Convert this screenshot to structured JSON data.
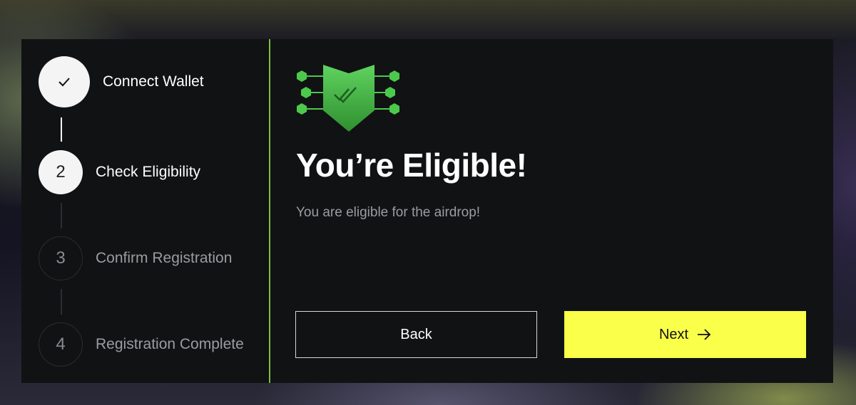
{
  "steps": [
    {
      "number": "",
      "label": "Connect Wallet",
      "state": "done",
      "icon": "check-icon"
    },
    {
      "number": "2",
      "label": "Check Eligibility",
      "state": "active"
    },
    {
      "number": "3",
      "label": "Confirm Registration",
      "state": "pending"
    },
    {
      "number": "4",
      "label": "Registration Complete",
      "state": "pending"
    }
  ],
  "main": {
    "badge_icon": "shield-double-check-icon",
    "title": "You’re Eligible!",
    "subtitle": "You are eligible for the airdrop!"
  },
  "buttons": {
    "back_label": "Back",
    "next_label": "Next",
    "next_icon": "arrow-right-icon"
  },
  "colors": {
    "accent_yellow": "#faff4a",
    "accent_green": "#4cc94c",
    "divider_green": "#7fbf3f",
    "card_bg": "#111214"
  }
}
